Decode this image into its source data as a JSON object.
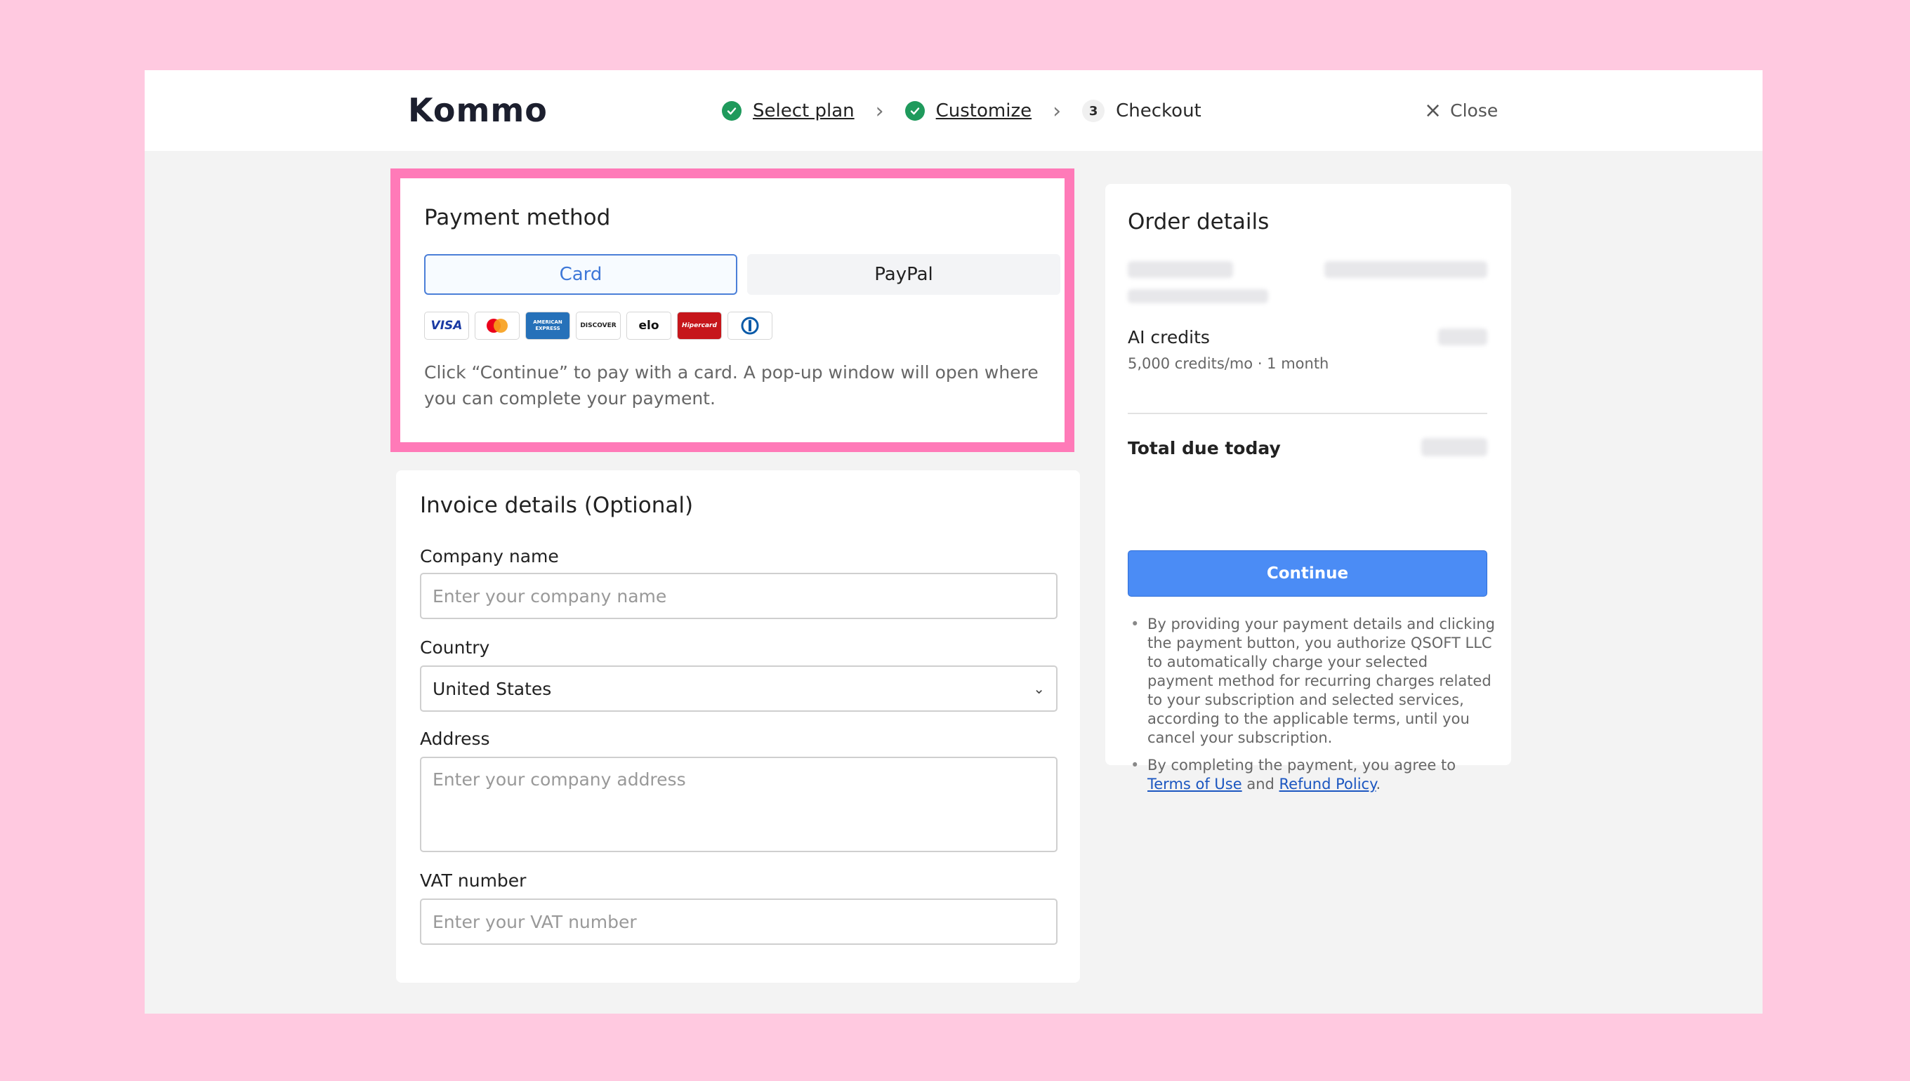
{
  "header": {
    "logo_text": "Kommo",
    "steps": [
      {
        "label": "Select plan",
        "status": "done"
      },
      {
        "label": "Customize",
        "status": "done"
      },
      {
        "label": "Checkout",
        "status": "current",
        "number": "3"
      }
    ],
    "close_label": "Close"
  },
  "payment": {
    "title": "Payment method",
    "tabs": [
      {
        "label": "Card",
        "active": true
      },
      {
        "label": "PayPal",
        "active": false
      }
    ],
    "card_logos": [
      "VISA",
      "mastercard",
      "AMERICAN EXPRESS",
      "DISCOVER",
      "elo",
      "Hipercard",
      "Diners Club"
    ],
    "note": "Click “Continue” to pay with a card. A pop-up window will open where you can complete your payment."
  },
  "invoice": {
    "title": "Invoice details (Optional)",
    "company_label": "Company name",
    "company_placeholder": "Enter your company name",
    "country_label": "Country",
    "country_value": "United States",
    "address_label": "Address",
    "address_placeholder": "Enter your company address",
    "vat_label": "VAT number",
    "vat_placeholder": "Enter your VAT number"
  },
  "order": {
    "title": "Order details",
    "ai_credits_title": "AI credits",
    "ai_credits_sub": "5,000 credits/mo · 1 month",
    "total_label": "Total due today",
    "continue_label": "Continue",
    "legal_1": "By providing your payment details and clicking the payment button, you authorize QSOFT LLC to automatically charge your selected payment method for recurring charges related to your subscription and selected services, according to the applicable terms, until you cancel your subscription.",
    "legal_2_prefix": "By completing the payment, you agree to ",
    "terms_link": "Terms of Use",
    "legal_2_and": " and ",
    "refund_link": "Refund Policy",
    "legal_2_suffix": "."
  },
  "colors": {
    "background": "#ffc9e0",
    "highlight": "#ff7ab8",
    "accent_blue": "#4b8cf5",
    "check_green": "#1f9a5c"
  }
}
